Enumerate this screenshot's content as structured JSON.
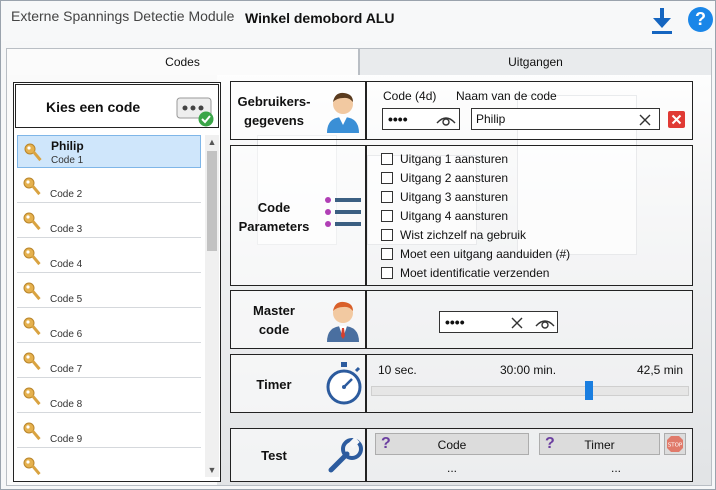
{
  "window": {
    "app_title": "Externe Spannings Detectie Module",
    "board_title": "Winkel demobord ALU"
  },
  "tabs": [
    {
      "label": "Codes",
      "active": true
    },
    {
      "label": "Uitgangen",
      "active": false
    }
  ],
  "codes_panel": {
    "header": "Kies een code",
    "items": [
      {
        "name": "Philip",
        "sub": "Code 1",
        "selected": true
      },
      {
        "name": "",
        "sub": "Code 2"
      },
      {
        "name": "",
        "sub": "Code 3"
      },
      {
        "name": "",
        "sub": "Code 4"
      },
      {
        "name": "",
        "sub": "Code 5"
      },
      {
        "name": "",
        "sub": "Code 6"
      },
      {
        "name": "",
        "sub": "Code 7"
      },
      {
        "name": "",
        "sub": "Code 8"
      },
      {
        "name": "",
        "sub": "Code 9"
      },
      {
        "name": "",
        "sub": ""
      }
    ]
  },
  "user": {
    "label_line1": "Gebruikers-",
    "label_line2": "gegevens",
    "code_label": "Code (4d)",
    "code_value": "••••",
    "name_label": "Naam van de code",
    "name_value": "Philip"
  },
  "params": {
    "label_line1": "Code",
    "label_line2": "Parameters",
    "options": [
      {
        "label": "Uitgang 1 aansturen",
        "checked": false
      },
      {
        "label": "Uitgang 2 aansturen",
        "checked": false
      },
      {
        "label": "Uitgang 3 aansturen",
        "checked": false
      },
      {
        "label": "Uitgang 4 aansturen",
        "checked": false
      },
      {
        "label": "Wist zichzelf na gebruik",
        "checked": false
      },
      {
        "label": "Moet een uitgang aanduiden (#)",
        "checked": false
      },
      {
        "label": "Moet identificatie verzenden",
        "checked": false
      }
    ]
  },
  "master": {
    "label_line1": "Master",
    "label_line2": "code",
    "value": "••••"
  },
  "timer": {
    "label": "Timer",
    "min_label": "10 sec.",
    "mid_label": "30:00 min.",
    "max_label": "42,5 min",
    "slider_fraction": 0.69
  },
  "test": {
    "label": "Test",
    "code_button": "Code",
    "timer_button": "Timer",
    "code_result": "...",
    "timer_result": "...",
    "stop_text": "STOP"
  },
  "colors": {
    "accent": "#1a7ee0",
    "delete": "#e03a34",
    "selected_bg": "#cfe6fb"
  }
}
